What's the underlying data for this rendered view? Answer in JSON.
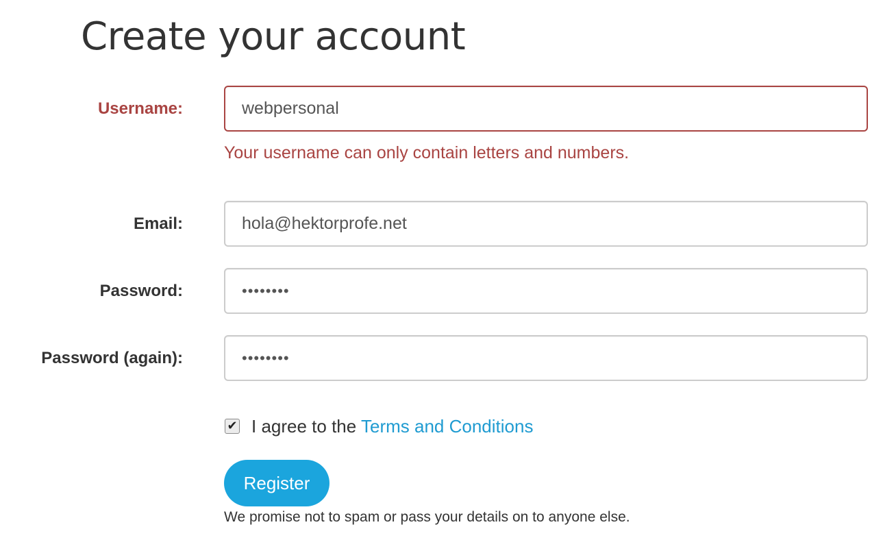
{
  "page": {
    "title": "Create your account"
  },
  "form": {
    "username": {
      "label": "Username:",
      "value": "webpersonal",
      "error": "Your username can only contain letters and numbers."
    },
    "email": {
      "label": "Email:",
      "value": "hola@hektorprofe.net"
    },
    "password": {
      "label": "Password:",
      "value": "••••••••"
    },
    "password_again": {
      "label": "Password (again):",
      "value": "••••••••"
    },
    "terms": {
      "checked": true,
      "check_mark": "✔",
      "prefix": "I agree to the ",
      "link_text": "Terms and Conditions"
    },
    "register_label": "Register",
    "disclaimer": "We promise not to spam or pass your details on to anyone else."
  },
  "colors": {
    "error": "#a94442",
    "link": "#1f9bd1",
    "button": "#1ba5dd",
    "input_border": "#cccccc"
  }
}
